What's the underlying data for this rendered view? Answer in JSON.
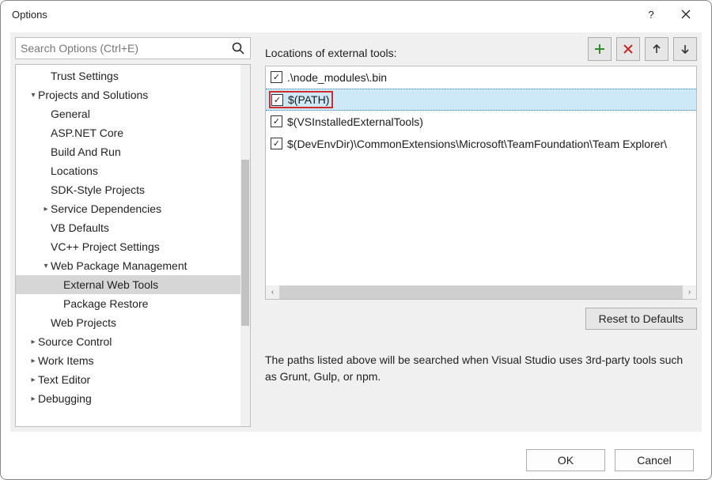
{
  "window": {
    "title": "Options"
  },
  "search": {
    "placeholder": "Search Options (Ctrl+E)"
  },
  "tree": [
    {
      "label": "Trust Settings",
      "indent": 32,
      "exp": ""
    },
    {
      "label": "Projects and Solutions",
      "indent": 16,
      "exp": "▾"
    },
    {
      "label": "General",
      "indent": 32,
      "exp": ""
    },
    {
      "label": "ASP.NET Core",
      "indent": 32,
      "exp": ""
    },
    {
      "label": "Build And Run",
      "indent": 32,
      "exp": ""
    },
    {
      "label": "Locations",
      "indent": 32,
      "exp": ""
    },
    {
      "label": "SDK-Style Projects",
      "indent": 32,
      "exp": ""
    },
    {
      "label": "Service Dependencies",
      "indent": 32,
      "exp": "▸"
    },
    {
      "label": "VB Defaults",
      "indent": 32,
      "exp": ""
    },
    {
      "label": "VC++ Project Settings",
      "indent": 32,
      "exp": ""
    },
    {
      "label": "Web Package Management",
      "indent": 32,
      "exp": "▾"
    },
    {
      "label": "External Web Tools",
      "indent": 48,
      "exp": "",
      "selected": true
    },
    {
      "label": "Package Restore",
      "indent": 48,
      "exp": ""
    },
    {
      "label": "Web Projects",
      "indent": 32,
      "exp": ""
    },
    {
      "label": "Source Control",
      "indent": 16,
      "exp": "▸"
    },
    {
      "label": "Work Items",
      "indent": 16,
      "exp": "▸"
    },
    {
      "label": "Text Editor",
      "indent": 16,
      "exp": "▸"
    },
    {
      "label": "Debugging",
      "indent": 16,
      "exp": "▸"
    }
  ],
  "panel": {
    "list_label": "Locations of external tools:",
    "rows": [
      {
        "text": ".\\node_modules\\.bin",
        "checked": true,
        "selected": false
      },
      {
        "text": "$(PATH)",
        "checked": true,
        "selected": true
      },
      {
        "text": "$(VSInstalledExternalTools)",
        "checked": true,
        "selected": false
      },
      {
        "text": "$(DevEnvDir)\\CommonExtensions\\Microsoft\\TeamFoundation\\Team Explorer\\",
        "checked": true,
        "selected": false
      }
    ],
    "reset_label": "Reset to Defaults",
    "description": "The paths listed above will be searched when Visual Studio uses 3rd-party tools such as Grunt, Gulp, or npm."
  },
  "icons": {
    "add_color": "#2e8b2e",
    "delete_color": "#c62828"
  },
  "footer": {
    "ok": "OK",
    "cancel": "Cancel"
  }
}
